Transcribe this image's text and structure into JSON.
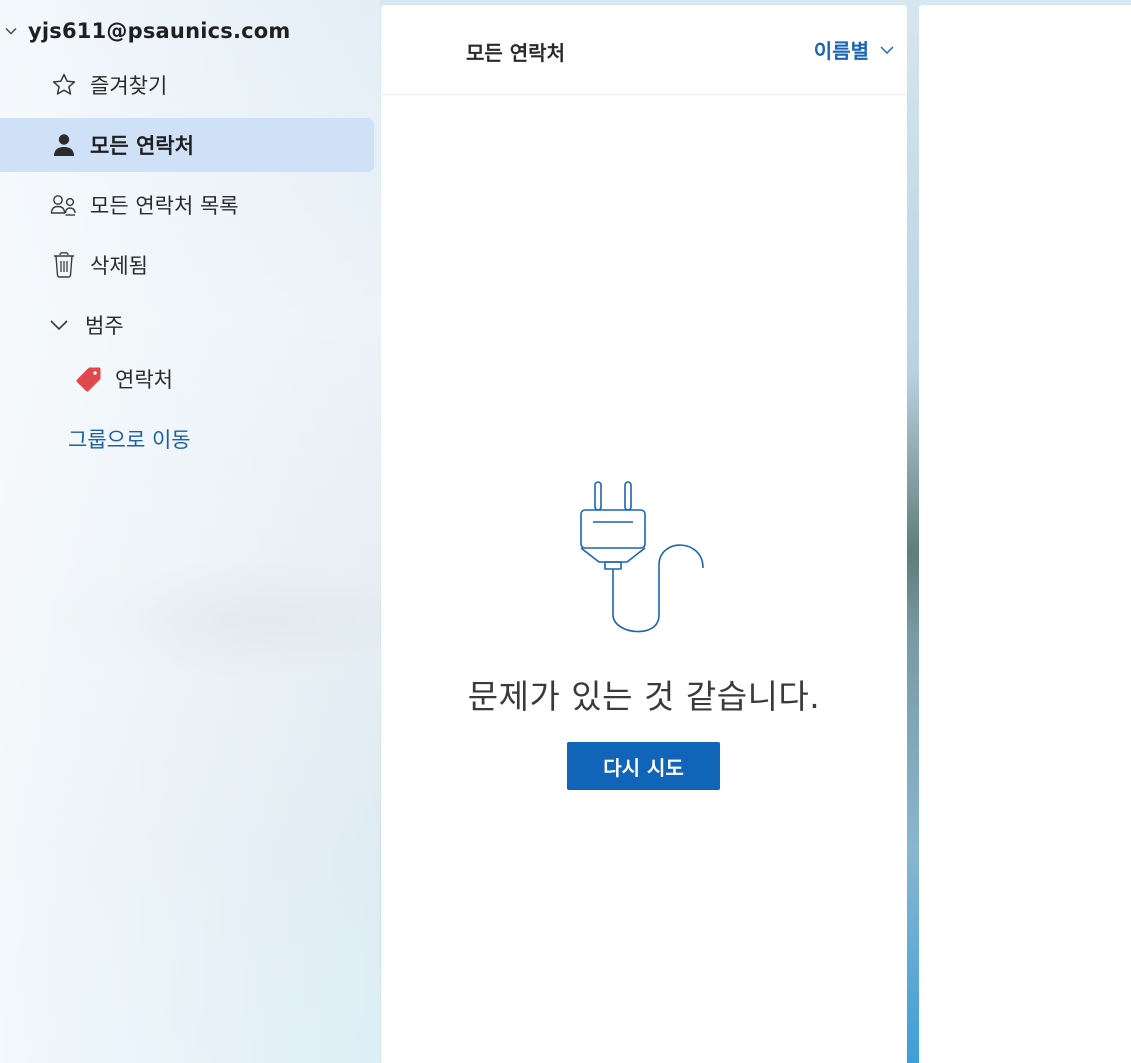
{
  "account": {
    "email": "yjs611@psaunics.com"
  },
  "nav": {
    "items": [
      {
        "label": "즐겨찾기",
        "icon": "star-icon"
      },
      {
        "label": "모든 연락처",
        "icon": "person-icon",
        "selected": true
      },
      {
        "label": "모든 연락처 목록",
        "icon": "people-list-icon"
      },
      {
        "label": "삭제됨",
        "icon": "trash-icon"
      }
    ],
    "categories": {
      "label": "범주",
      "items": [
        {
          "label": "연락처",
          "icon": "tag-icon",
          "color": "#e0474f"
        }
      ]
    },
    "goto_groups": "그룹으로 이동"
  },
  "list": {
    "title": "모든 연락처",
    "sort_label": "이름별",
    "error_message": "문제가 있는 것 같습니다.",
    "retry_label": "다시 시도",
    "illustration": "unplugged-cable-icon"
  },
  "colors": {
    "accent": "#1165b9",
    "selected_bg": "#cfe1f7",
    "link": "#1a5fa8"
  }
}
